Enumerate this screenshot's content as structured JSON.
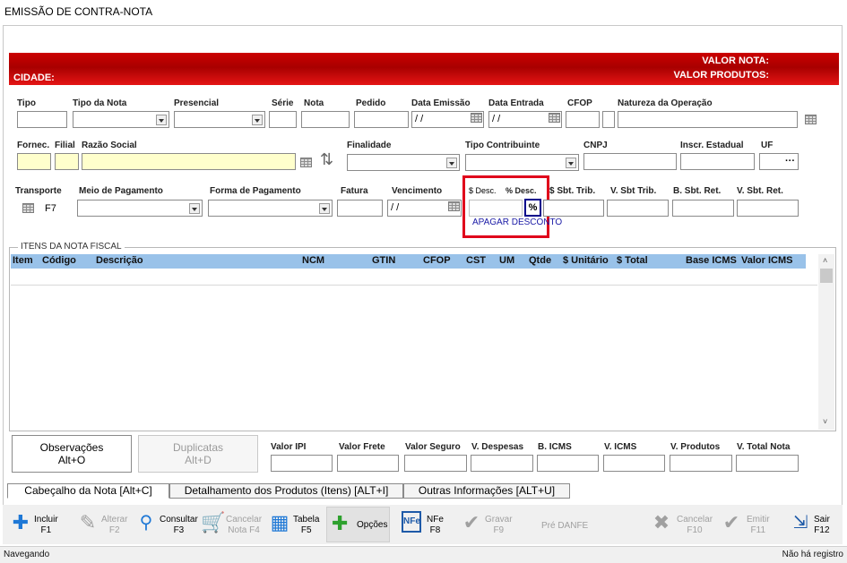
{
  "window": {
    "title": "EMISSÃO DE CONTRA-NOTA"
  },
  "nav": {
    "first": "⏮",
    "prev": "◀",
    "next": "▶",
    "last": "⏭"
  },
  "header": {
    "cidade_label": "CIDADE:",
    "valor_nota_label": "VALOR NOTA:",
    "valor_produtos_label": "VALOR PRODUTOS:"
  },
  "row1": {
    "tipo": "Tipo",
    "tipo_nota": "Tipo da Nota",
    "presencial": "Presencial",
    "serie": "Série",
    "nota": "Nota",
    "pedido": "Pedido",
    "data_emissao": "Data Emissão",
    "data_emissao_value": "/ /",
    "data_entrada": "Data Entrada",
    "data_entrada_value": "/ /",
    "cfop": "CFOP",
    "natureza": "Natureza da Operação"
  },
  "row2": {
    "fornec": "Fornec.",
    "filial": "Filial",
    "razao_social": "Razão Social",
    "finalidade": "Finalidade",
    "tipo_contribuinte": "Tipo Contribuinte",
    "cnpj": "CNPJ",
    "inscr_estadual": "Inscr. Estadual",
    "uf": "UF",
    "uf_button": "···"
  },
  "row3": {
    "transporte": "Transporte",
    "f7": "F7",
    "meio_pagamento": "Meio de Pagamento",
    "forma_pagamento": "Forma de Pagamento",
    "fatura": "Fatura",
    "vencimento": "Vencimento",
    "vencimento_value": "/ /",
    "desc_valor": "$ Desc.",
    "desc_percent": "% Desc.",
    "pct_button": "%",
    "apagar_desconto": "APAGAR DESCONTO",
    "sbt_trib": "$ Sbt. Trib.",
    "v_sbt_trib": "V. Sbt Trib.",
    "b_sbt_ret": "B. Sbt. Ret.",
    "v_sbt_ret": "V. Sbt. Ret."
  },
  "items": {
    "title": "ITENS DA NOTA FISCAL",
    "columns": [
      "Item",
      "Código",
      "Descrição",
      "NCM",
      "GTIN",
      "CFOP",
      "CST",
      "UM",
      "Qtde",
      "$ Unitário",
      "$ Total",
      "Base ICMS",
      "Valor ICMS"
    ]
  },
  "footer": {
    "observacoes": "Observações",
    "observacoes_key": "Alt+O",
    "duplicatas": "Duplicatas",
    "duplicatas_key": "Alt+D",
    "valor_ipi": "Valor IPI",
    "valor_frete": "Valor Frete",
    "valor_seguro": "Valor Seguro",
    "v_despesas": "V. Despesas",
    "b_icms": "B. ICMS",
    "v_icms": "V. ICMS",
    "v_produtos": "V. Produtos",
    "v_total_nota": "V. Total Nota"
  },
  "tabs": [
    {
      "label": "Cabeçalho da Nota  [Alt+C]"
    },
    {
      "label": "Detalhamento dos Produtos (Itens)  [ALT+I]"
    },
    {
      "label": "Outras Informações [ALT+U]"
    }
  ],
  "toolbar": {
    "incluir": "Incluir",
    "incluir_key": "F1",
    "alterar": "Alterar",
    "alterar_key": "F2",
    "consultar": "Consultar",
    "consultar_key": "F3",
    "cancelar_nota": "Cancelar",
    "cancelar_nota_2": "Nota F4",
    "tabela": "Tabela",
    "tabela_key": "F5",
    "opcoes": "Opções",
    "nfe": "NFe",
    "nfe_key": "F8",
    "gravar": "Gravar",
    "gravar_key": "F9",
    "pre_danfe": "Pré DANFE",
    "cancelar": "Cancelar",
    "cancelar_key": "F10",
    "emitir": "Emitir",
    "emitir_key": "F11",
    "sair": "Sair",
    "sair_key": "F12"
  },
  "status": {
    "left": "Navegando",
    "right": "Não há registro"
  }
}
